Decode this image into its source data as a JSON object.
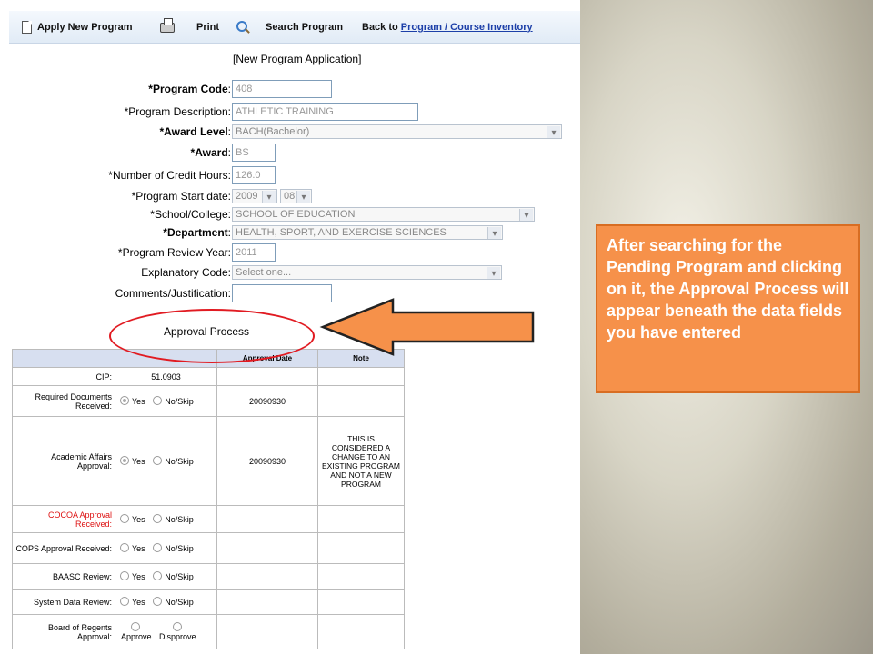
{
  "toolbar": {
    "apply": "Apply New Program",
    "print": "Print",
    "search": "Search Program",
    "back_prefix": "Back to",
    "back_link": "Program / Course Inventory"
  },
  "form": {
    "title": "[New Program Application]",
    "fields": [
      {
        "req": "*",
        "label": "Program Code",
        "value": "408"
      },
      {
        "req": "*",
        "label": "Program Description",
        "value": "ATHLETIC TRAINING"
      },
      {
        "req": "*",
        "label": "Award Level",
        "value": "BACH(Bachelor)"
      },
      {
        "req": "*",
        "label": "Award",
        "value": "BS"
      },
      {
        "req": "*",
        "label": "Number of Credit Hours",
        "value": "126.0"
      },
      {
        "req": "*",
        "label": "Program Start date",
        "year": "2009",
        "month": "08"
      },
      {
        "req": "*",
        "label": "School/College",
        "value": "SCHOOL OF EDUCATION"
      },
      {
        "req": "*",
        "label": "Department",
        "value": "HEALTH, SPORT, AND EXERCISE SCIENCES"
      },
      {
        "req": "*",
        "label": "Program Review Year",
        "value": "2011"
      },
      {
        "req": "",
        "label": "Explanatory Code",
        "value": "Select one..."
      },
      {
        "req": "",
        "label": "Comments/Justification",
        "value": ""
      }
    ]
  },
  "approval": {
    "title": "Approval Process",
    "headers": [
      "",
      "",
      "Approval Date",
      "Note"
    ],
    "cip_label": "CIP:",
    "cip_value": "51.0903",
    "yes": "Yes",
    "noskip": "No/Skip",
    "approve": "Approve",
    "disapprove": "Dispprove",
    "rows": [
      {
        "label": "Required Documents Received:",
        "date": "20090930",
        "note": "",
        "checked": "yes"
      },
      {
        "label": "Academic Affairs Approval:",
        "date": "20090930",
        "note": "THIS IS CONSIDERED A CHANGE TO AN EXISTING PROGRAM AND NOT A NEW PROGRAM",
        "checked": "yes"
      },
      {
        "label": "COCOA Approval Received:",
        "date": "",
        "note": "",
        "checked": ""
      },
      {
        "label": "COPS Approval Received:",
        "date": "",
        "note": "",
        "checked": ""
      },
      {
        "label": "BAASC Review:",
        "date": "",
        "note": "",
        "checked": ""
      },
      {
        "label": "System Data Review:",
        "date": "",
        "note": "",
        "checked": ""
      },
      {
        "label": "Board of Regents Approval:",
        "date": "",
        "note": "",
        "checked": ""
      }
    ]
  },
  "callout": {
    "text": "After searching for the Pending Program and clicking on it, the Approval Process will appear beneath the data fields you have entered"
  },
  "colors": {
    "callout_bg": "#f6914a",
    "arrow_fill": "#f6914a",
    "ellipse": "#e11b22",
    "required_red_label": "#d11111"
  }
}
